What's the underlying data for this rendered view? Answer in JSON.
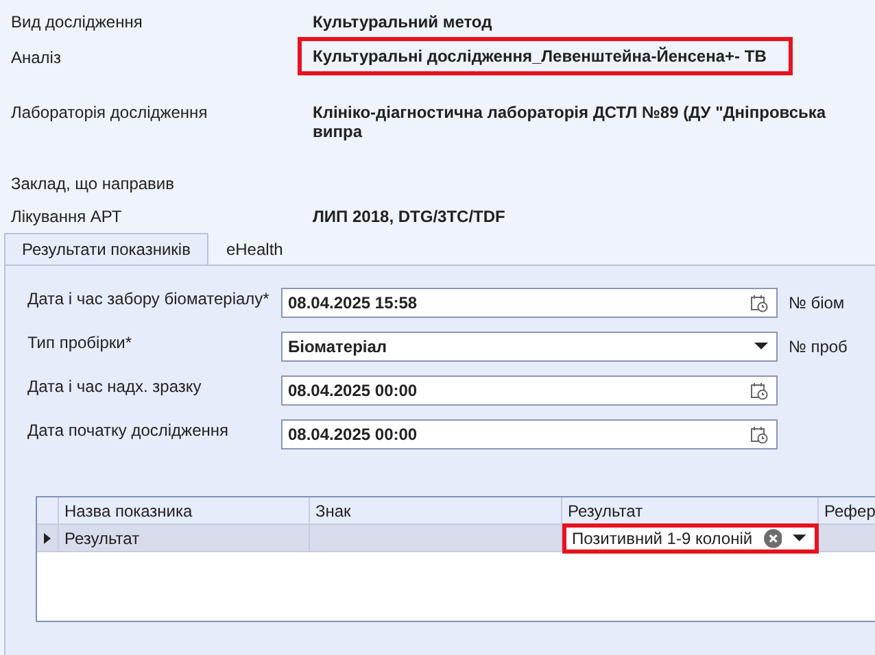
{
  "info_rows": [
    {
      "label": "Вид дослідження",
      "value": "Культуральний метод"
    },
    {
      "label": "Аналіз",
      "value": "Культуральні дослідження_Левенштейна-Йенсена+- ТВ",
      "highlighted": true
    },
    {
      "label": "Лабораторія дослідження",
      "value": "Клініко-діагностична лабораторія ДСТЛ №89 (ДУ \"Дніпровська випра"
    },
    {
      "label": "Заклад, що направив"
    },
    {
      "label": "Лікування АРТ",
      "value": "ЛИП 2018, DTG/3TC/TDF"
    }
  ],
  "tabs": [
    {
      "label": "Результати показників",
      "selected": true
    },
    {
      "label": "eHealth",
      "selected": false
    }
  ],
  "form_fields": [
    {
      "label": "Дата і час забору біоматеріалу*",
      "kind": "date",
      "value": "08.04.2025 15:58",
      "side_label": "№ біом"
    },
    {
      "label": "Тип пробірки*",
      "kind": "select",
      "value": "Біоматеріал",
      "side_label": "№ проб"
    },
    {
      "label": "Дата і час надх. зразку",
      "kind": "date",
      "value": "08.04.2025 00:00"
    },
    {
      "label": "Дата початку дослідження",
      "kind": "date",
      "value": "08.04.2025 00:00"
    }
  ],
  "table": {
    "columns": [
      "Назва показника",
      "Знак",
      "Результат",
      "Рефер"
    ],
    "rows": [
      {
        "current": true,
        "cells": [
          "Результат",
          "",
          "Позитивний 1-9 колоній",
          ""
        ],
        "result_highlighted": true
      }
    ]
  }
}
